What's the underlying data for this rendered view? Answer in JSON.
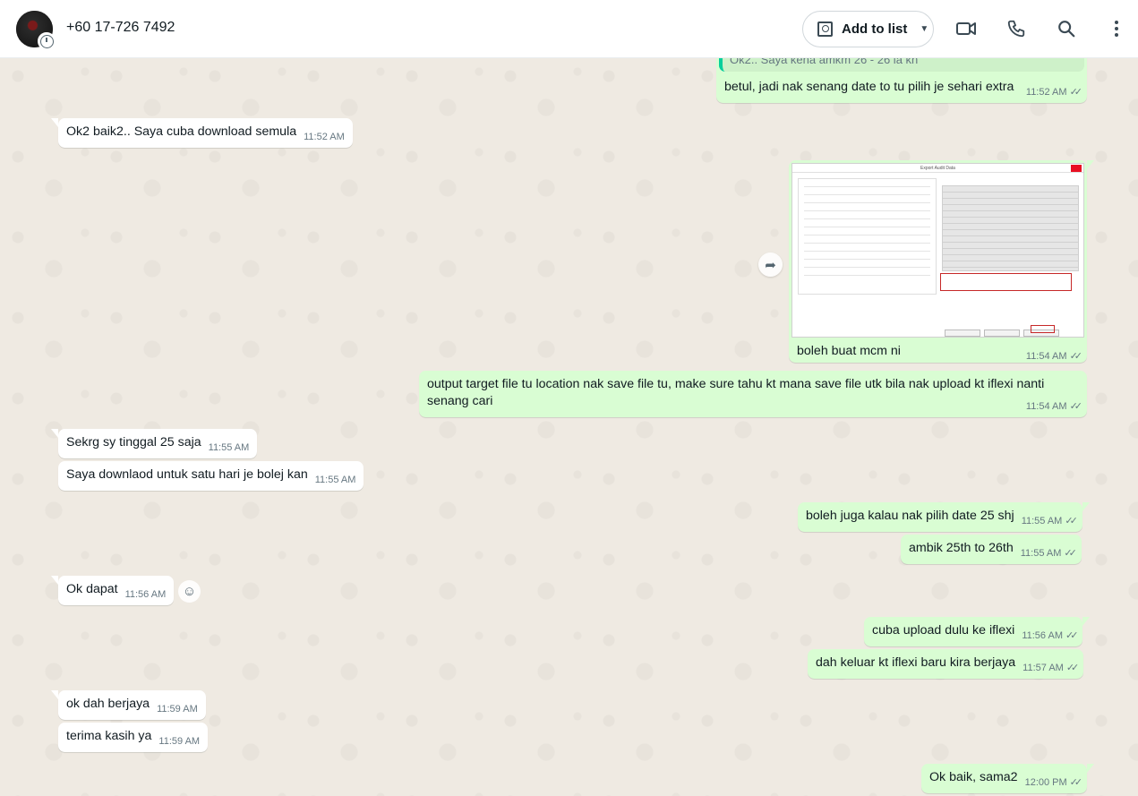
{
  "header": {
    "contact_name": "+60 17-726 7492",
    "add_to_list_label": "Add to list"
  },
  "messages": [
    {
      "dir": "out",
      "quote": "Ok2.. Saya kena amkm 26 - 26 la kn",
      "text": "betul, jadi nak senang date to tu pilih je sehari extra",
      "time": "11:52 AM"
    },
    {
      "dir": "in",
      "text": "Ok2 baik2.. Saya cuba download semula",
      "time": "11:52 AM"
    },
    {
      "dir": "out",
      "image": "Export Audit Data",
      "text": "boleh buat mcm ni",
      "time": "11:54 AM"
    },
    {
      "dir": "out",
      "text": "output target file tu location nak save file tu, make sure tahu kt mana save file utk bila nak upload kt iflexi nanti senang cari",
      "time": "11:54 AM"
    },
    {
      "dir": "in",
      "text": "Sekrg sy tinggal 25 saja",
      "time": "11:55 AM"
    },
    {
      "dir": "in",
      "text": "Saya downlaod untuk satu hari je bolej kan",
      "time": "11:55 AM"
    },
    {
      "dir": "out",
      "text": "boleh juga kalau nak pilih date 25 shj",
      "time": "11:55 AM"
    },
    {
      "dir": "out",
      "text": "ambik 25th to 26th",
      "time": "11:55 AM"
    },
    {
      "dir": "in",
      "text": "Ok dapat",
      "time": "11:56 AM"
    },
    {
      "dir": "out",
      "text": "cuba upload dulu ke iflexi",
      "time": "11:56 AM"
    },
    {
      "dir": "out",
      "text": "dah keluar kt iflexi baru kira berjaya",
      "time": "11:57 AM"
    },
    {
      "dir": "in",
      "text": "ok dah berjaya",
      "time": "11:59 AM"
    },
    {
      "dir": "in",
      "text": "terima kasih ya",
      "time": "11:59 AM"
    },
    {
      "dir": "out",
      "text": "Ok baik, sama2",
      "time": "12:00 PM"
    }
  ],
  "icons": [
    "video-call-icon",
    "voice-call-icon",
    "search-icon",
    "menu-icon",
    "forward-icon",
    "emoji-react-icon",
    "read-receipt-icon"
  ],
  "colors": {
    "outgoing_bubble": "#d9fdd3",
    "incoming_bubble": "#ffffff",
    "chat_background": "#efeae2",
    "quote_bar": "#06cf9c"
  }
}
